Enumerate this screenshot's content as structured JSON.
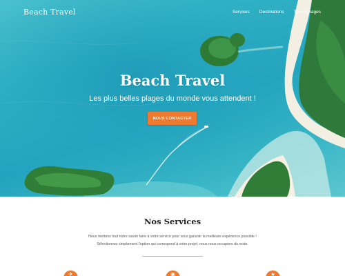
{
  "nav": {
    "brand": "Beach Travel",
    "links": [
      "Services",
      "Destinations",
      "Témoignages"
    ]
  },
  "hero": {
    "title": "Beach Travel",
    "subtitle": "Les plus belles plages du monde vous attendent !",
    "cta_label": "NOUS CONTACTER"
  },
  "services": {
    "title": "Nos Services",
    "text_line1": "Nous mettons tout notre savoir faire à votre service pour vous garantir la meilleure expérience possible !",
    "text_line2": "Sélectionnez simplement l'option qui correspond à votre projet, nous nous occupons du reste.",
    "icons": [
      "plane-icon",
      "globe-icon",
      "star-icon"
    ]
  },
  "colors": {
    "accent": "#ee7a30",
    "divider": "#8ec9e6",
    "sea": "#2fb0c4"
  }
}
